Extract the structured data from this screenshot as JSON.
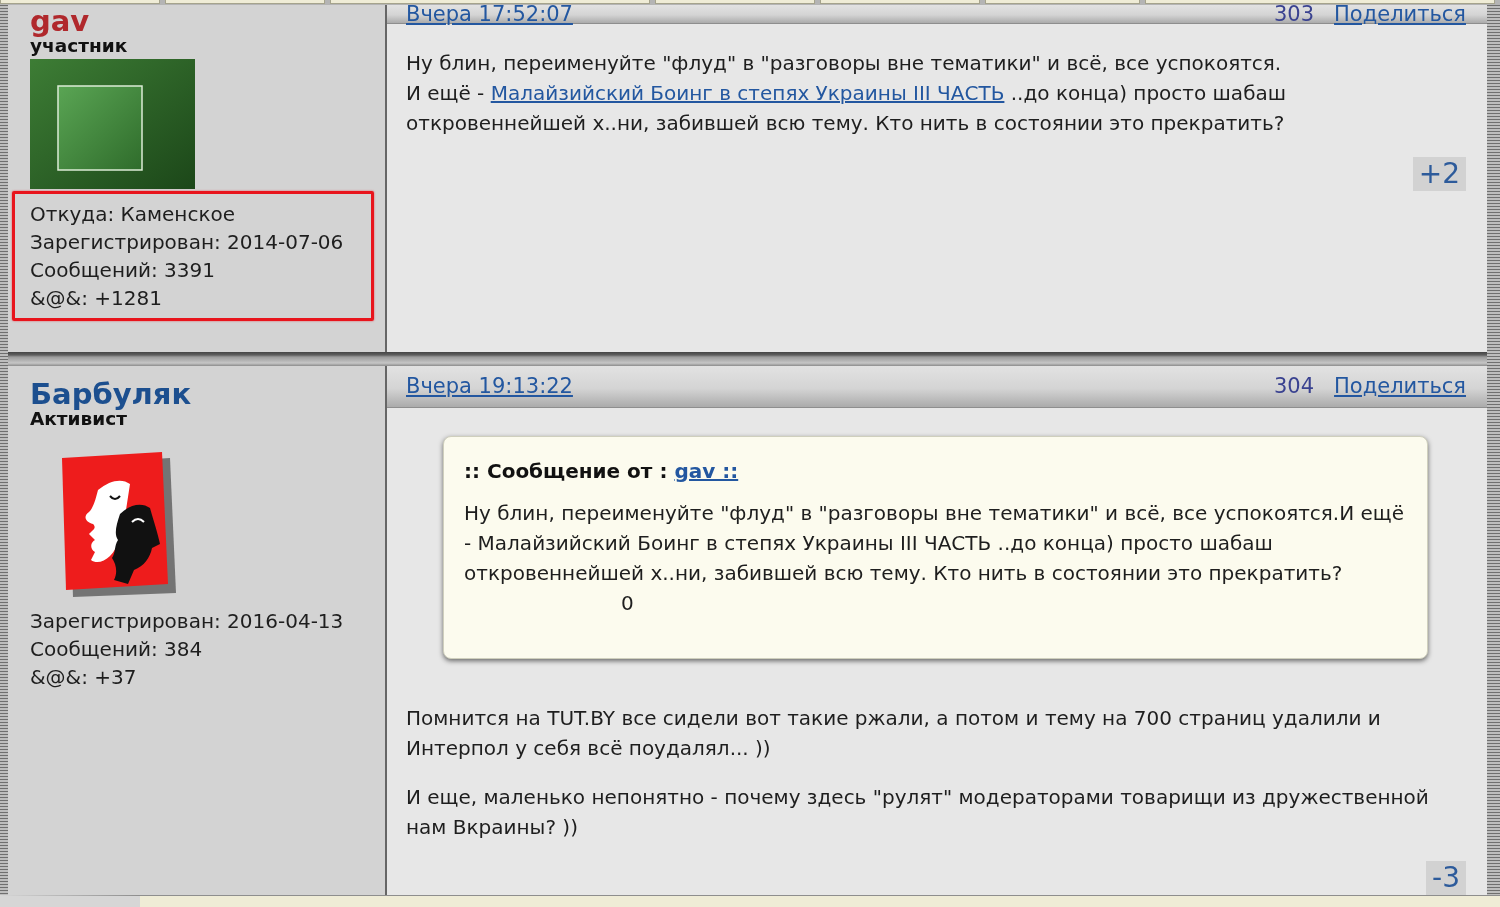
{
  "posts": [
    {
      "author": {
        "name": "gav",
        "color": "#b0282c",
        "rank": "участник",
        "avatar": {
          "kind": "element-tile"
        },
        "highlighted": true,
        "info": [
          "Откуда: Каменское",
          "Зарегистрирован: 2014-07-06",
          "Сообщений: 3391",
          "&@&: +1281"
        ]
      },
      "date": "Вчера 17:52:07",
      "number": "303",
      "share": "Поделиться",
      "content": [
        {
          "kind": "paragraph",
          "parts": [
            {
              "kind": "text",
              "text": "Ну блин, переименуйте \"флуд\" в \"разговоры вне тематики\" и всё, все успокоятся."
            },
            {
              "kind": "break"
            },
            {
              "kind": "text",
              "text": "И ещё - "
            },
            {
              "kind": "link",
              "text": "Малайзийский Боинг в степях Украины III ЧАСТЬ"
            },
            {
              "kind": "text",
              "text": " ..до конца) просто шабаш откровеннейшей х..ни, забившей всю тему. Кто нить в состоянии это прекратить?"
            }
          ]
        }
      ],
      "rating": "+2"
    },
    {
      "author": {
        "name": "Барбуляк",
        "color": "#1c4f8f",
        "rank": "Активист",
        "avatar": {
          "kind": "masks"
        },
        "highlighted": false,
        "info": [
          "Зарегистрирован: 2016-04-13",
          "Сообщений: 384",
          "&@&: +37"
        ]
      },
      "date": "Вчера 19:13:22",
      "number": "304",
      "share": "Поделиться",
      "content": [
        {
          "kind": "quote",
          "label": ":: Сообщение от :",
          "author": "gav ::",
          "text": "Ну блин, переименуйте \"флуд\" в \"разговоры вне тематики\" и всё, все успокоятся.И ещё - Малайзийский Боинг в степях Украины III ЧАСТЬ ..до конца) просто шабаш откровеннейшей х..ни, забившей всю тему. Кто нить в состоянии это прекратить?",
          "rating": "0"
        },
        {
          "kind": "paragraph",
          "parts": [
            {
              "kind": "text",
              "text": "Помнится на TUT.BY все сидели вот такие ржали, а потом и тему на 700 страниц удалили и Интерпол у себя всё поудалял... ))"
            }
          ]
        },
        {
          "kind": "paragraph",
          "parts": [
            {
              "kind": "text",
              "text": "И еще, маленько непонятно - почему здесь \"рулят\" модераторами товарищи из дружественной нам Вкраины? ))"
            }
          ]
        }
      ],
      "rating": "-3"
    }
  ]
}
